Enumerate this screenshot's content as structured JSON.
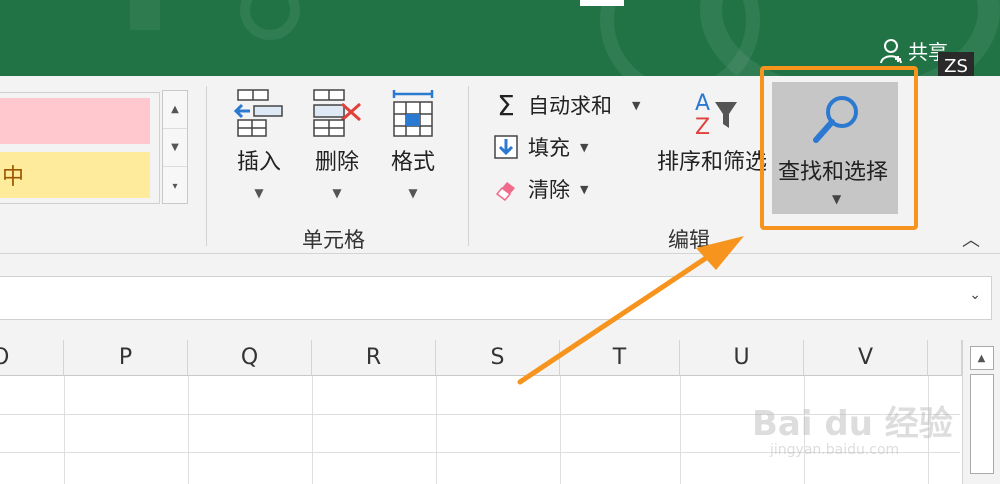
{
  "titlebar": {
    "share_label": "共享",
    "user_badge": "ZS",
    "accent": "#217346"
  },
  "styles": {
    "pink_label": "",
    "yellow_label": "中",
    "more_icon": "chevron-down-icon"
  },
  "cells_group": {
    "label": "单元格",
    "buttons": [
      {
        "label": "插入",
        "icon": "insert-cells-icon"
      },
      {
        "label": "删除",
        "icon": "delete-cells-icon"
      },
      {
        "label": "格式",
        "icon": "format-cells-icon"
      }
    ]
  },
  "editing_group": {
    "label": "编辑",
    "autosum": "自动求和",
    "fill": "填充",
    "clear": "清除",
    "sort_filter": "排序和筛选",
    "find_select": "查找和选择"
  },
  "columns": [
    "O",
    "P",
    "Q",
    "R",
    "S",
    "T",
    "U",
    "V"
  ],
  "watermark": {
    "brand": "Bai du 经验",
    "url": "jingyan.baidu.com"
  },
  "highlight_color": "#f7941d"
}
